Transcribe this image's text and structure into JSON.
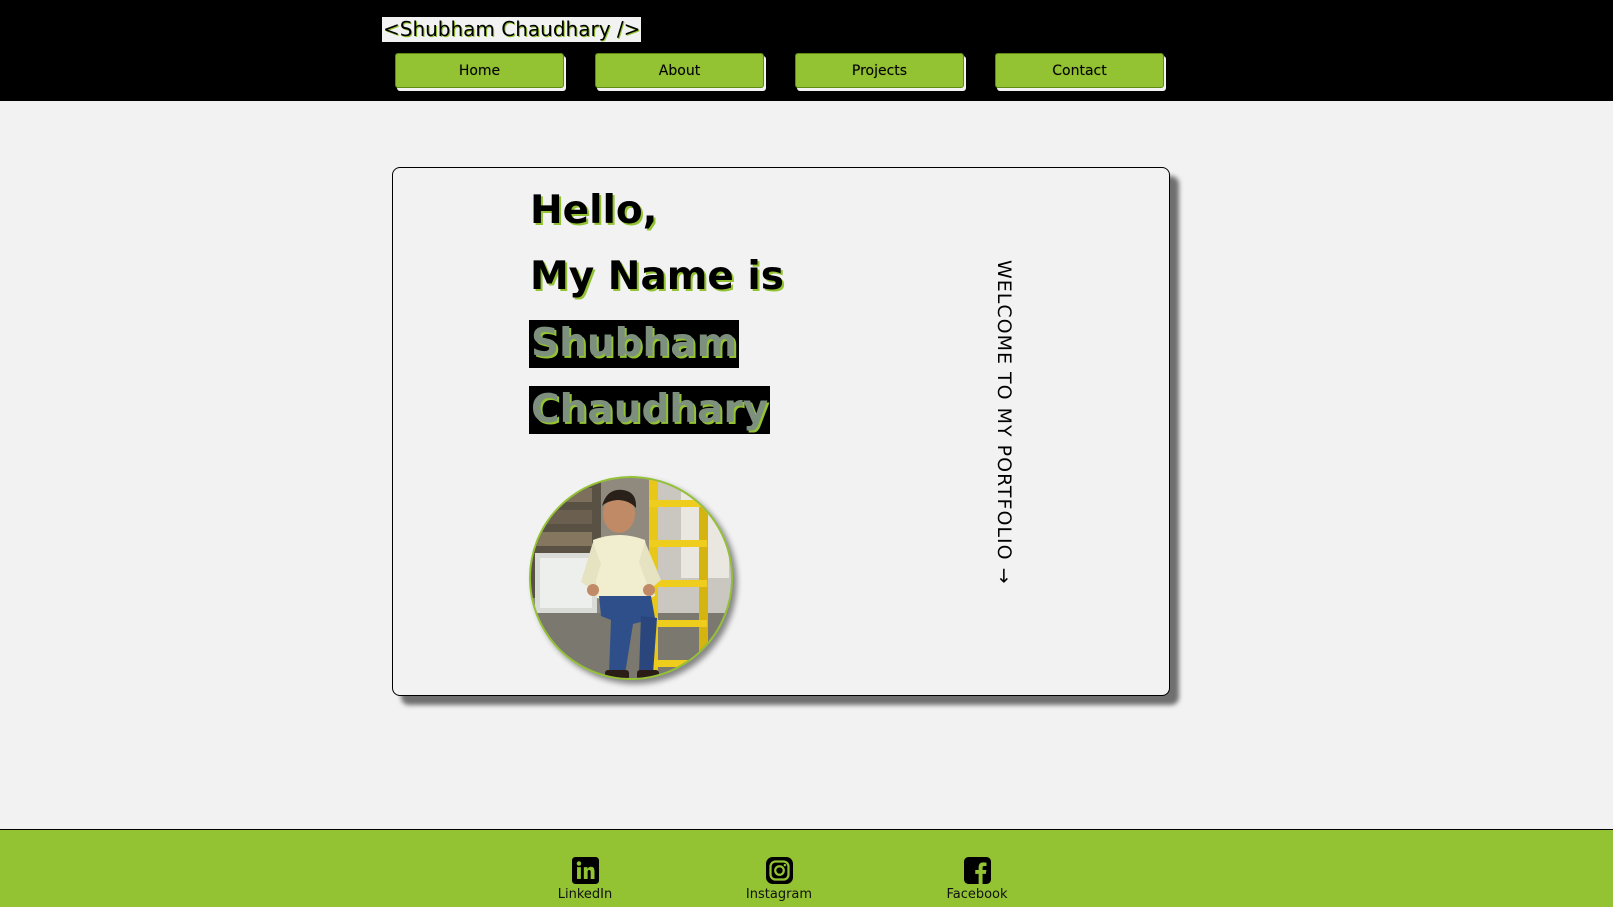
{
  "header": {
    "brand": "<Shubham Chaudhary />",
    "nav": [
      {
        "label": "Home"
      },
      {
        "label": "About"
      },
      {
        "label": "Projects"
      },
      {
        "label": "Contact"
      }
    ]
  },
  "hero": {
    "greeting_line1": "Hello,",
    "greeting_line2": "My Name is",
    "first_name": "Shubham",
    "last_name": "Chaudhary",
    "welcome_text": "WELCOME TO MY PORTFOLIO →",
    "photo": "profile-photo"
  },
  "footer": {
    "links": [
      {
        "label": "LinkedIn",
        "icon": "linkedin-icon"
      },
      {
        "label": "Instagram",
        "icon": "instagram-icon"
      },
      {
        "label": "Facebook",
        "icon": "facebook-icon"
      }
    ]
  },
  "colors": {
    "accent": "#93c233",
    "header_bg": "#000000",
    "page_bg": "#f2f2f2",
    "text": "#000000"
  }
}
